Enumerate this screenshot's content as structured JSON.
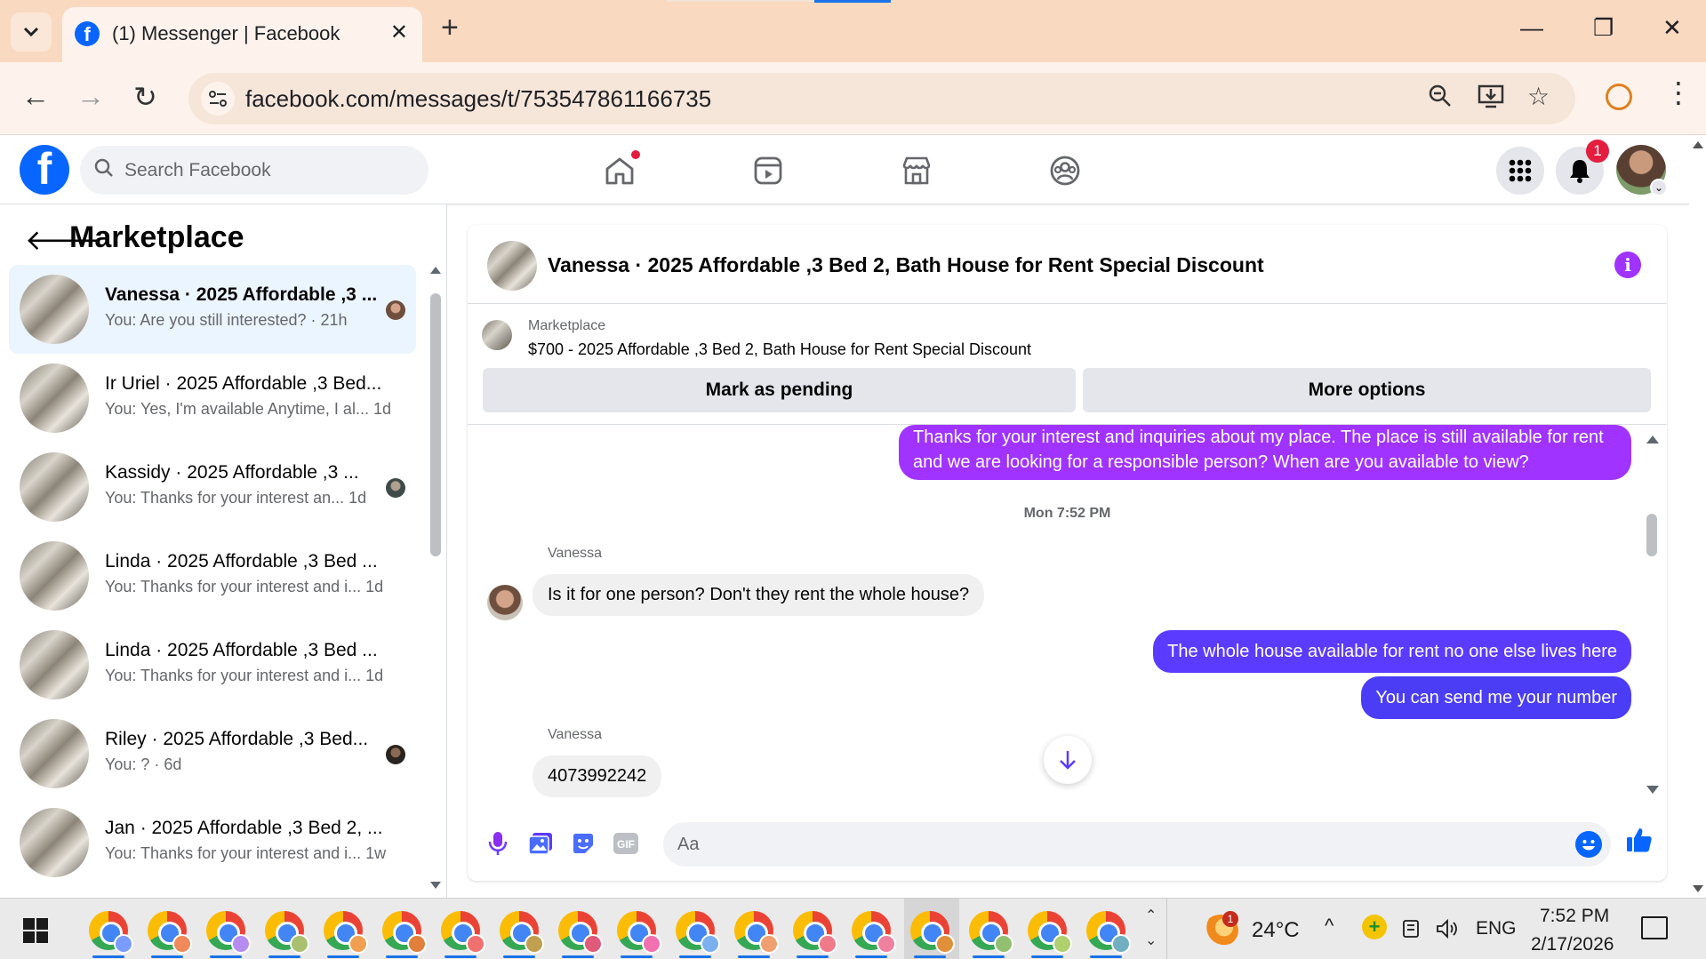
{
  "browser": {
    "tab_title": "(1) Messenger | Facebook",
    "url": "facebook.com/messages/t/753547861166735"
  },
  "header": {
    "search_placeholder": "Search Facebook",
    "notification_count": "1",
    "nav_icons": [
      "home-icon",
      "reels-icon",
      "marketplace-icon",
      "groups-icon"
    ]
  },
  "sidebar": {
    "title": "Marketplace",
    "conversations": [
      {
        "name": "Vanessa · 2025 Affordable ,3 ...",
        "snippet": "You: Are you still interested? · 21h",
        "active": true
      },
      {
        "name": "Ir Uriel · 2025 Affordable ,3 Bed...",
        "snippet": "You: Yes, I'm available Anytime, I al...  1d"
      },
      {
        "name": "Kassidy · 2025 Affordable ,3 ...",
        "snippet": "You: Thanks for your interest an...  1d"
      },
      {
        "name": "Linda · 2025 Affordable ,3 Bed ...",
        "snippet": "You: Thanks for your interest and i...  1d"
      },
      {
        "name": "Linda · 2025 Affordable ,3 Bed ...",
        "snippet": "You: Thanks for your interest and i...  1d"
      },
      {
        "name": "Riley · 2025 Affordable ,3 Bed...",
        "snippet": "You: ? · 6d"
      },
      {
        "name": "Jan · 2025 Affordable ,3 Bed 2, ...",
        "snippet": "You: Thanks for your interest and i...  1w"
      }
    ]
  },
  "chat": {
    "title": "Vanessa · 2025 Affordable ,3 Bed 2, Bath House for Rent Special Discount",
    "listing_label": "Marketplace",
    "listing_desc": "$700 - 2025 Affordable ,3 Bed 2, Bath House for Rent Special Discount",
    "mark_pending": "Mark as pending",
    "more_options": "More options",
    "msg_out_1": "Thanks for your interest and inquiries about my place. The place is still available for rent and we are looking for a responsible person? When are you available to view?",
    "timestamp": "Mon 7:52 PM",
    "sender_1": "Vanessa",
    "msg_in_1": "Is it for one person? Don't they rent the whole house?",
    "msg_out_2": "The whole house available for rent no one else lives here",
    "msg_out_3": "You can send me your number",
    "sender_2": "Vanessa",
    "msg_in_2": "4073992242",
    "composer_placeholder": "Aa",
    "gif_label": "GIF"
  },
  "taskbar": {
    "temperature": "24°C",
    "weather_badge": "1",
    "language": "ENG",
    "time": "7:52 PM",
    "date": "2/17/2026"
  },
  "colors": {
    "fb_blue": "#0866ff",
    "bubble_purple": "#a033ff",
    "bubble_violet": "#8a2ff0",
    "bubble_indigo": "#5b3bff",
    "bubble_blue": "#4a3df5"
  }
}
